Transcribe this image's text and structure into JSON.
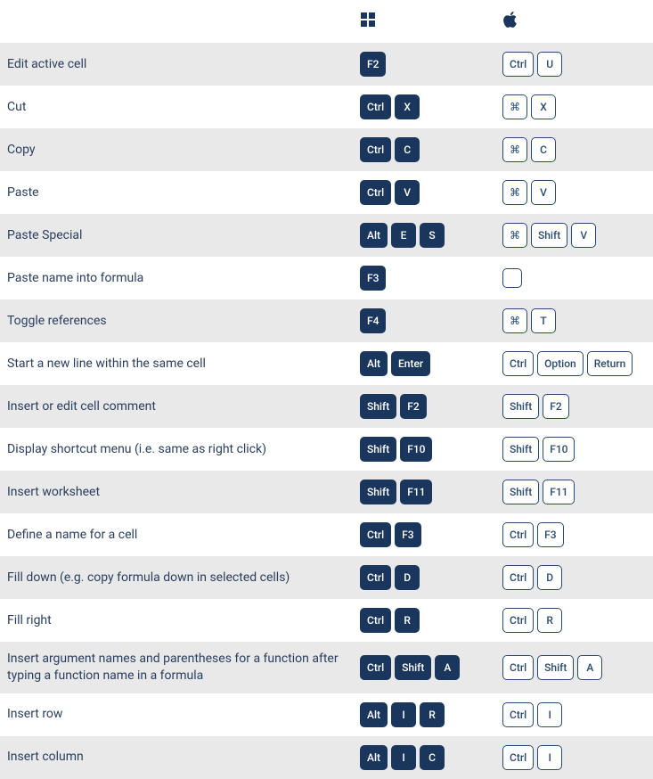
{
  "table": {
    "rows": [
      {
        "desc": "Edit active cell",
        "win": [
          "F2"
        ],
        "mac": [
          "Ctrl",
          "U"
        ]
      },
      {
        "desc": "Cut",
        "win": [
          "Ctrl",
          "X"
        ],
        "mac": [
          "⌘",
          "X"
        ]
      },
      {
        "desc": "Copy",
        "win": [
          "Ctrl",
          "C"
        ],
        "mac": [
          "⌘",
          "C"
        ]
      },
      {
        "desc": "Paste",
        "win": [
          "Ctrl",
          "V"
        ],
        "mac": [
          "⌘",
          "V"
        ]
      },
      {
        "desc": "Paste Special",
        "win": [
          "Alt",
          "E",
          "S"
        ],
        "mac": [
          "⌘",
          "Shift",
          "V"
        ]
      },
      {
        "desc": "Paste name into formula",
        "win": [
          "F3"
        ],
        "mac": [
          ""
        ]
      },
      {
        "desc": "Toggle references",
        "win": [
          "F4"
        ],
        "mac": [
          "⌘",
          "T"
        ]
      },
      {
        "desc": "Start a new line within the same cell",
        "win": [
          "Alt",
          "Enter"
        ],
        "mac": [
          "Ctrl",
          "Option",
          "Return"
        ]
      },
      {
        "desc": "Insert or edit cell comment",
        "win": [
          "Shift",
          "F2"
        ],
        "mac": [
          "Shift",
          "F2"
        ]
      },
      {
        "desc": "Display shortcut menu (i.e. same as right click)",
        "win": [
          "Shift",
          "F10"
        ],
        "mac": [
          "Shift",
          "F10"
        ]
      },
      {
        "desc": "Insert worksheet",
        "win": [
          "Shift",
          "F11"
        ],
        "mac": [
          "Shift",
          "F11"
        ]
      },
      {
        "desc": "Define a name for a cell",
        "win": [
          "Ctrl",
          "F3"
        ],
        "mac": [
          "Ctrl",
          "F3"
        ]
      },
      {
        "desc": "Fill down (e.g. copy formula down in selected cells)",
        "win": [
          "Ctrl",
          "D"
        ],
        "mac": [
          "Ctrl",
          "D"
        ]
      },
      {
        "desc": "Fill right",
        "win": [
          "Ctrl",
          "R"
        ],
        "mac": [
          "Ctrl",
          "R"
        ]
      },
      {
        "desc": "Insert argument names and parentheses for a function after typing a function name in a formula",
        "win": [
          "Ctrl",
          "Shift",
          "A"
        ],
        "mac": [
          "Ctrl",
          "Shift",
          "A"
        ]
      },
      {
        "desc": "Insert row",
        "win": [
          "Alt",
          "I",
          "R"
        ],
        "mac": [
          "Ctrl",
          "I"
        ]
      },
      {
        "desc": "Insert column",
        "win": [
          "Alt",
          "I",
          "C"
        ],
        "mac": [
          "Ctrl",
          "I"
        ]
      }
    ]
  }
}
